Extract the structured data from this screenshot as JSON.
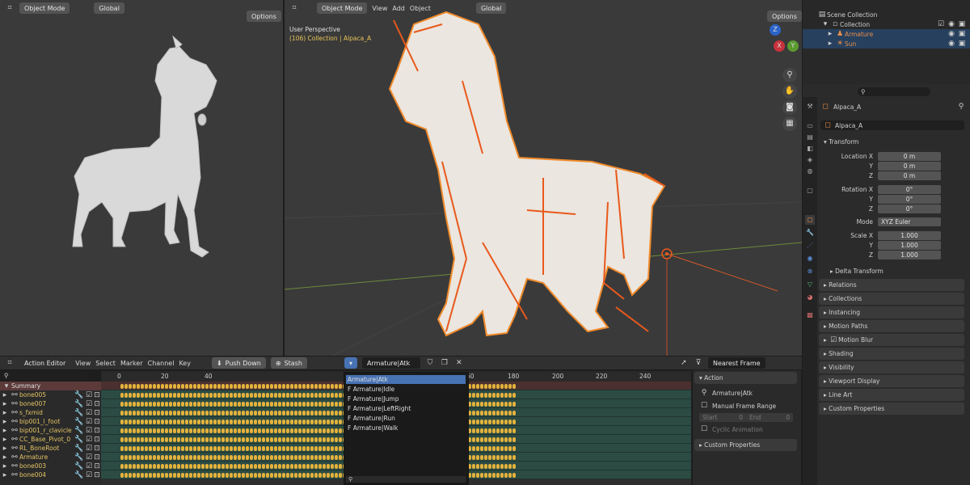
{
  "left_viewport": {
    "mode": "Object Mode",
    "orientation": "Global",
    "options": "Options"
  },
  "main_viewport": {
    "mode": "Object Mode",
    "menus": [
      "View",
      "Add",
      "Object"
    ],
    "orientation": "Global",
    "options": "Options",
    "perspective": "User Perspective",
    "collection_info": "(106) Collection | Alpaca_A",
    "gizmo": {
      "z": "Z",
      "y": "Y",
      "x": "X"
    }
  },
  "outliner": {
    "search_placeholder": "",
    "items": [
      {
        "label": "Scene Collection"
      },
      {
        "label": "Collection"
      },
      {
        "label": "Armature"
      },
      {
        "label": "Sun"
      }
    ]
  },
  "properties": {
    "object_name": "Alpaca_A",
    "data_name": "Alpaca_A",
    "transform_label": "Transform",
    "location_x_label": "Location X",
    "y_label": "Y",
    "z_label": "Z",
    "location": [
      "0 m",
      "0 m",
      "0 m"
    ],
    "rotation_x_label": "Rotation X",
    "rotation": [
      "0°",
      "0°",
      "0°"
    ],
    "mode_label": "Mode",
    "mode_value": "XYZ Euler",
    "scale_x_label": "Scale X",
    "scale": [
      "1.000",
      "1.000",
      "1.000"
    ],
    "delta_transform": "Delta Transform",
    "sections": [
      "Relations",
      "Collections",
      "Instancing",
      "Motion Paths",
      "Motion Blur",
      "Shading",
      "Visibility",
      "Viewport Display",
      "Line Art",
      "Custom Properties"
    ]
  },
  "action_editor": {
    "editor_type": "Action Editor",
    "menus": [
      "View",
      "Select",
      "Marker",
      "Channel",
      "Key"
    ],
    "push_down": "Push Down",
    "stash": "Stash",
    "action_name": "Armature|Atk",
    "snap": "Nearest Frame",
    "frame_numbers": [
      "0",
      "20",
      "40",
      "60",
      "180",
      "200",
      "220",
      "240"
    ],
    "channels": [
      "Summary",
      "bone005",
      "bone007",
      "s_fxmid",
      "bip001_l_foot",
      "bip001_r_clavicle",
      "CC_Base_Pivot_0",
      "RL_BoneRoot",
      "Armature",
      "bone003",
      "bone004"
    ]
  },
  "action_dropdown": {
    "items": [
      "Armature|Atk",
      "Armature|Idle",
      "Armature|Jump",
      "Armature|LeftRight",
      "Armature|Run",
      "Armature|Walk"
    ]
  },
  "action_panel": {
    "section": "Action",
    "action_name": "Armature|Atk",
    "manual_frame_range": "Manual Frame Range",
    "start_label": "Start",
    "start_value": "0",
    "end_label": "End",
    "end_value": "0",
    "cyclic": "Cyclic Animation",
    "custom_props": "Custom Properties"
  }
}
